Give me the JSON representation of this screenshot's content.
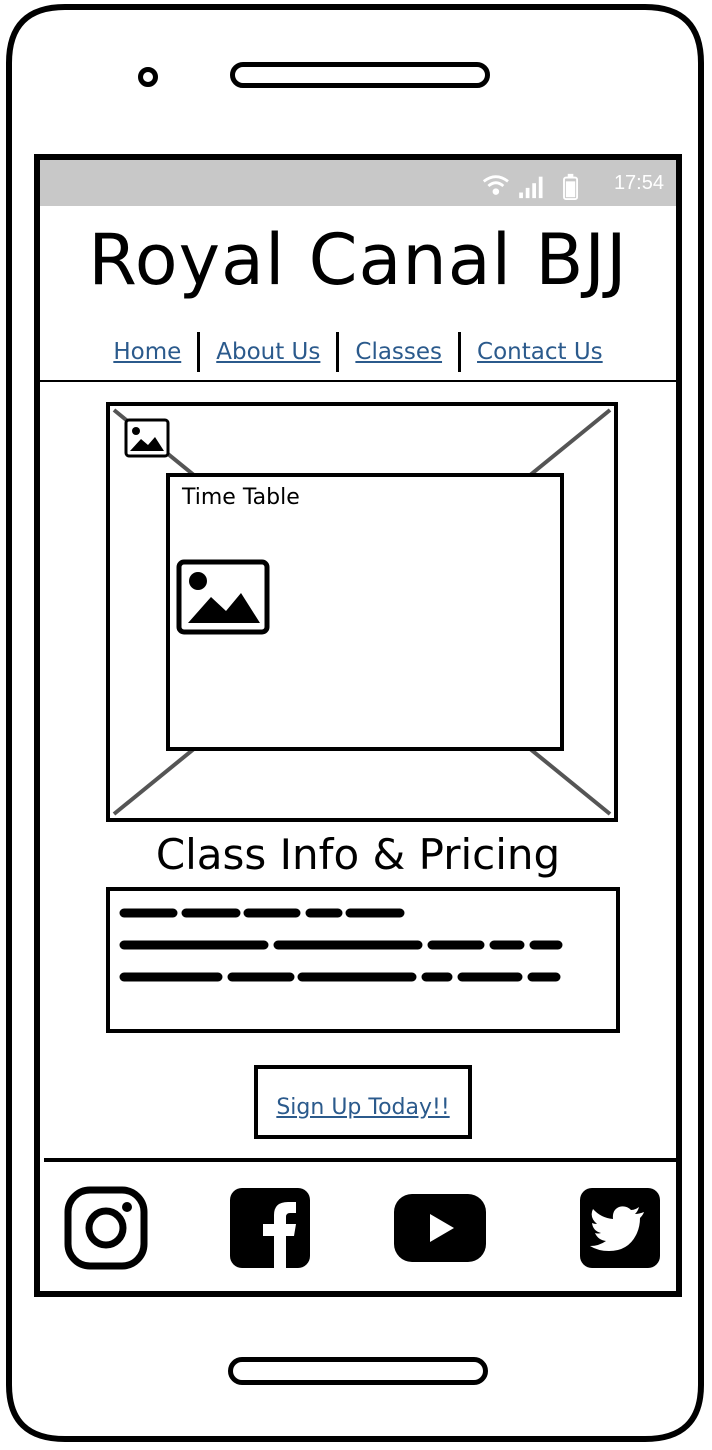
{
  "status_bar": {
    "time": "17:54",
    "icons": [
      "wifi-icon",
      "signal-icon",
      "battery-icon"
    ]
  },
  "header": {
    "title": "Royal Canal BJJ"
  },
  "nav": {
    "items": [
      {
        "label": "Home"
      },
      {
        "label": "About Us"
      },
      {
        "label": "Classes"
      },
      {
        "label": "Contact Us"
      }
    ]
  },
  "hero": {
    "image_icon": "image-placeholder-icon",
    "timetable_label": "Time Table",
    "timetable_image_icon": "image-placeholder-icon"
  },
  "classes": {
    "heading": "Class Info & Pricing"
  },
  "cta": {
    "label": "Sign Up Today!!"
  },
  "footer": {
    "social": [
      "instagram-icon",
      "facebook-icon",
      "youtube-icon",
      "twitter-icon"
    ]
  },
  "colors": {
    "link": "#2b5a8c",
    "status_bar": "#c8c8c8"
  }
}
